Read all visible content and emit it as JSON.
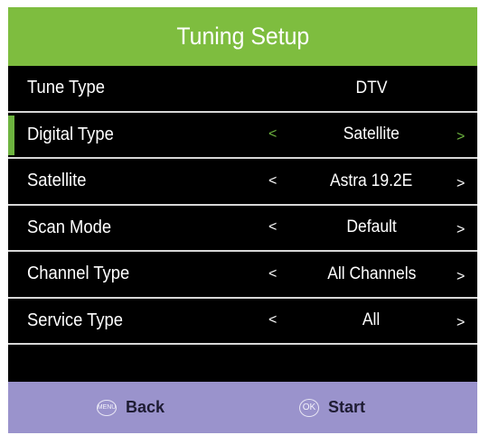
{
  "header": {
    "title": "Tuning Setup"
  },
  "rows": [
    {
      "label": "Tune Type",
      "value": "DTV",
      "left_arrow": "",
      "right_arrow": ""
    },
    {
      "label": "Digital Type",
      "value": "Satellite",
      "left_arrow": "<",
      "right_arrow": ">"
    },
    {
      "label": "Satellite",
      "value": "Astra 19.2E",
      "left_arrow": "<",
      "right_arrow": ">"
    },
    {
      "label": "Scan Mode",
      "value": "Default",
      "left_arrow": "<",
      "right_arrow": ">"
    },
    {
      "label": "Channel Type",
      "value": "All Channels",
      "left_arrow": "<",
      "right_arrow": ">"
    },
    {
      "label": "Service Type",
      "value": "All",
      "left_arrow": "<",
      "right_arrow": ">"
    }
  ],
  "selected_row": "Digital Type",
  "footer": {
    "back_icon": "MENU",
    "back_label": "Back",
    "start_icon": "OK",
    "start_label": "Start"
  },
  "colors": {
    "header_bg": "#7ebd3f",
    "panel_bg": "#000000",
    "footer_bg": "#9a93cc",
    "selection_accent": "#6db33f",
    "divider": "#d7d7d7"
  }
}
